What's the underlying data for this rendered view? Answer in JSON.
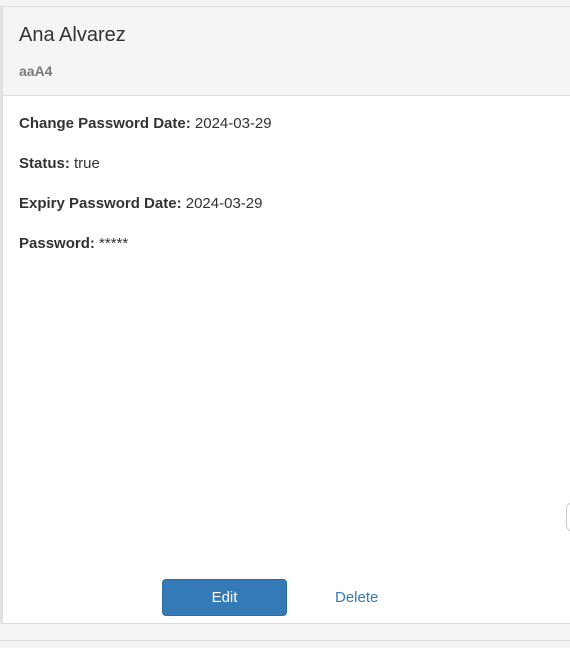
{
  "card": {
    "title": "Ana Alvarez",
    "subtitle": "aaA4",
    "fields": [
      {
        "label": "Change Password Date:",
        "value": "2024-03-29"
      },
      {
        "label": "Status:",
        "value": "true"
      },
      {
        "label": "Expiry Password Date:",
        "value": "2024-03-29"
      },
      {
        "label": "Password:",
        "value": "*****"
      }
    ],
    "actions": {
      "edit_label": "Edit",
      "delete_label": "Delete"
    }
  },
  "colors": {
    "primary": "#337ab7",
    "header_bg": "#f5f5f5",
    "subtitle": "#7b7b7b"
  }
}
